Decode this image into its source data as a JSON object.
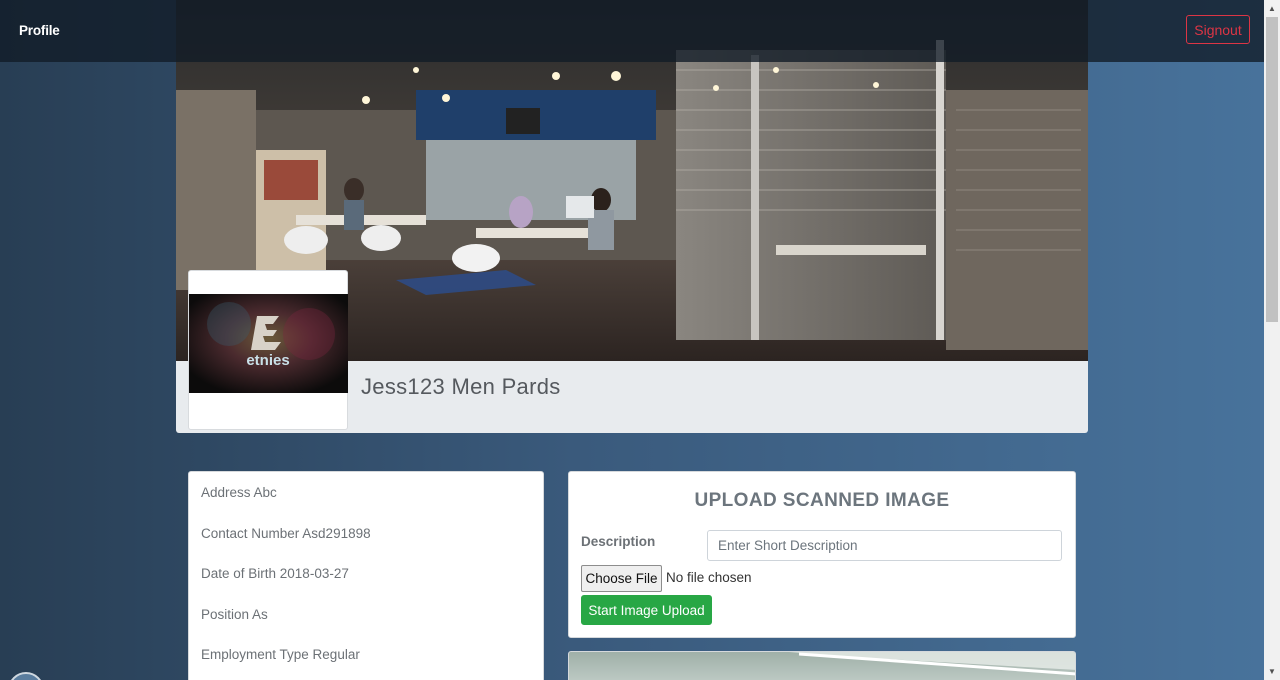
{
  "navbar": {
    "brand": "Profile",
    "signout_label": "Signout"
  },
  "profile": {
    "name": "Jess123 Men Pards",
    "avatar_logo_text": "etnies"
  },
  "info": {
    "rows": [
      "Address Abc",
      "Contact Number Asd291898",
      "Date of Birth 2018-03-27",
      "Position As",
      "Employment Type Regular"
    ]
  },
  "upload": {
    "title": "UPLOAD SCANNED IMAGE",
    "description_label": "Description",
    "description_placeholder": "Enter Short Description",
    "description_value": "",
    "choose_file_label": "Choose File",
    "no_file_text": "No file chosen",
    "submit_label": "Start Image Upload"
  },
  "colors": {
    "accent_danger": "#dc3545",
    "accent_success": "#28a745"
  },
  "icons": {
    "scroll_up": "scroll-up-arrow-icon",
    "scroll_down": "scroll-down-arrow-icon"
  }
}
